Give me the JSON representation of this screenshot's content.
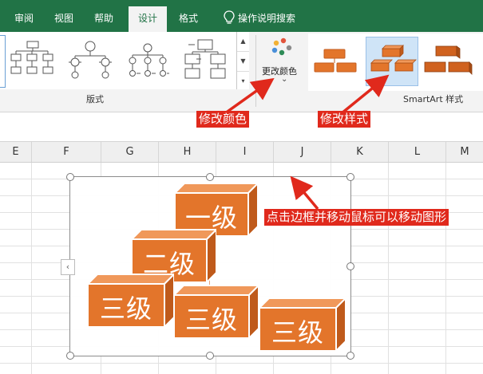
{
  "tabs": [
    {
      "label": "审阅"
    },
    {
      "label": "视图"
    },
    {
      "label": "帮助"
    },
    {
      "label": "设计"
    },
    {
      "label": "格式"
    },
    {
      "label": "操作说明搜索"
    }
  ],
  "ribbon": {
    "layouts_group_label": "版式",
    "change_colors_label": "更改颜色",
    "smartart_styles_label": "SmartArt 样式",
    "scroll_up": "▲",
    "scroll_down": "▼",
    "scroll_more": "▾",
    "colors_dropdown": "⌄"
  },
  "columns": [
    "E",
    "F",
    "G",
    "H",
    "I",
    "J",
    "K",
    "L",
    "M"
  ],
  "annotations": {
    "colors": "修改颜色",
    "styles": "修改样式",
    "move": "点击边框并移动鼠标可以移动图形"
  },
  "smartart": {
    "levels": [
      "一级",
      "二级",
      "三级",
      "三级",
      "三级"
    ],
    "expander": "‹",
    "fill": "#e3752b",
    "fill_dark": "#bf5a1b",
    "fill_top": "#f0985a"
  },
  "colors": {
    "ribbon_green": "#217346",
    "annotation_red": "#e0291c"
  }
}
